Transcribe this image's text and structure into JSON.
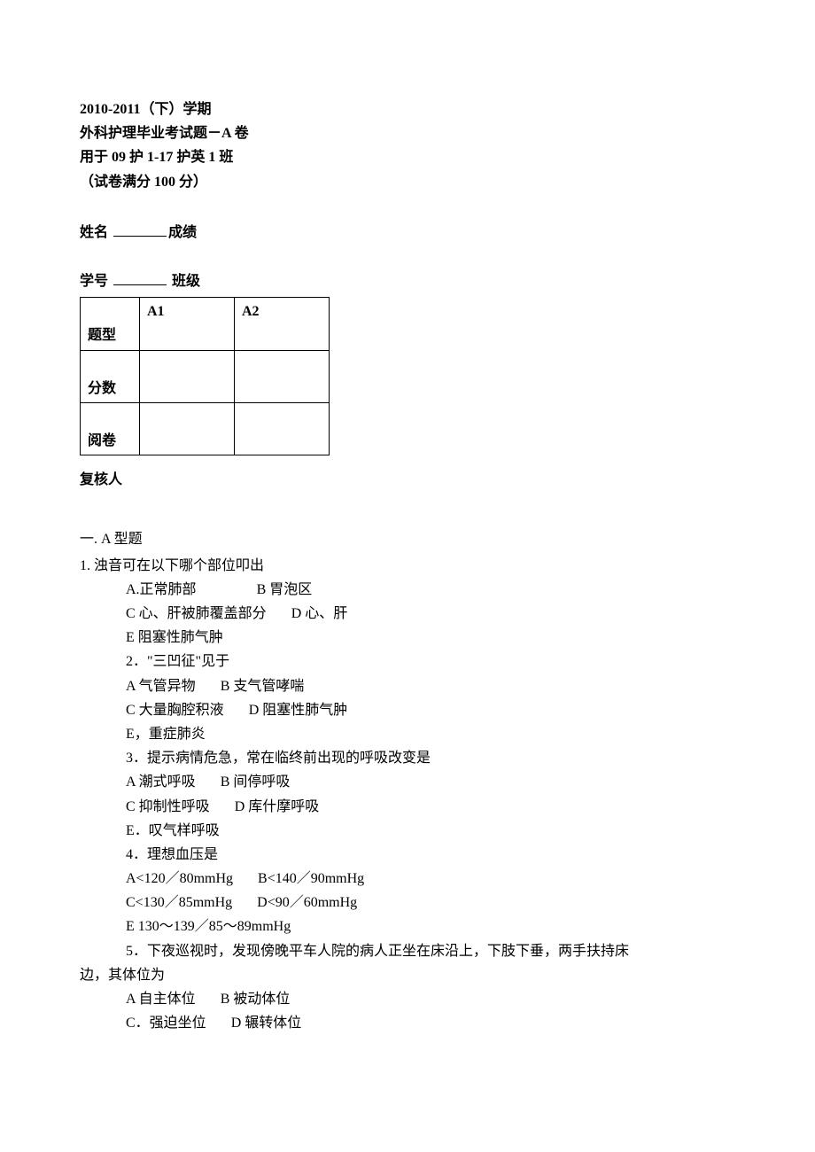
{
  "header": {
    "line1": "2010-2011（下）学期",
    "line2": "外科护理毕业考试题－A 卷",
    "line3": "用于 09 护 1-17 护英 1 班",
    "line4": "（试卷满分 100 分）"
  },
  "info": {
    "name_label": "姓名",
    "score_label": "成绩",
    "student_id_label": "学号",
    "class_label": "班级"
  },
  "table": {
    "r1c1": "题型",
    "r1c2": "A1",
    "r1c3": "A2",
    "r2c1": "分数",
    "r3c1": "阅卷"
  },
  "reviewer_label": "复核人",
  "section_a_title": "一. A 型题",
  "q1": {
    "stem": "1.   浊音可在以下哪个部位叩出",
    "a": "A.正常肺部",
    "b": "B 胃泡区",
    "c": "C 心、肝被肺覆盖部分",
    "d": "D 心、肝",
    "e": "E 阻塞性肺气肿"
  },
  "q2": {
    "stem": "2．\"三凹征\"见于",
    "a": "A 气管异物",
    "b": "B 支气管哮喘",
    "c": "C 大量胸腔积液",
    "d": "D 阻塞性肺气肿",
    "e": "E，重症肺炎"
  },
  "q3": {
    "stem": "3．提示病情危急，常在临终前出现的呼吸改变是",
    "a": "A 潮式呼吸",
    "b": "B 间停呼吸",
    "c": "C 抑制性呼吸",
    "d": "D 库什摩呼吸",
    "e": "E．叹气样呼吸"
  },
  "q4": {
    "stem": "4．理想血压是",
    "a": "A<120／80mmHg",
    "b": "B<140／90mmHg",
    "c": "C<130／85mmHg",
    "d": "D<90／60mmHg",
    "e": "E 130～139／85～89mmHg"
  },
  "q5": {
    "stem_part1": "5．下夜巡视时，发现傍晚平车人院的病人正坐在床沿上，下肢下垂，两手扶持床",
    "stem_part2": "边，其体位为",
    "a": "A 自主体位",
    "b": "B 被动体位",
    "c": "C．强迫坐位",
    "d": "D 辗转体位"
  }
}
